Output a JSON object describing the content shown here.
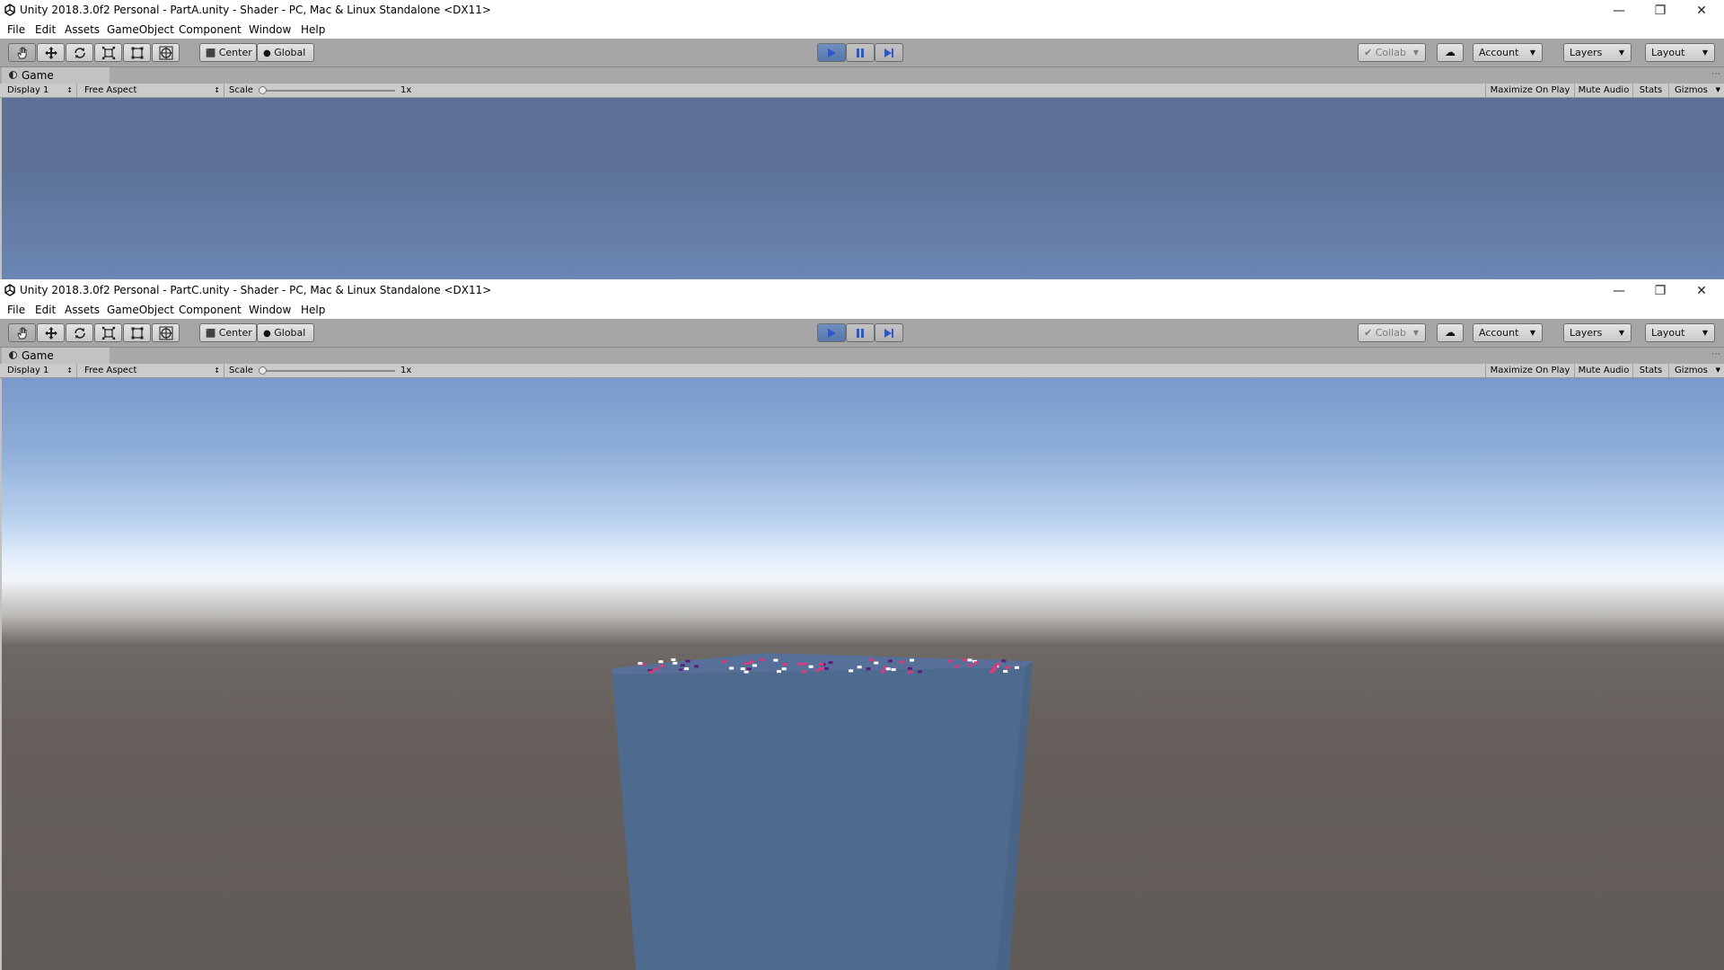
{
  "colors": {
    "cube_face": "#4f6a8f",
    "cube_side": "#4a6488",
    "cube_top": "#56709a",
    "pink": "#dc3a78",
    "purple": "#5b1f7a",
    "white": "#ffffff"
  },
  "windows": [
    {
      "title": "Unity 2018.3.0f2 Personal - PartA.unity - Shader - PC, Mac & Linux Standalone <DX11>"
    },
    {
      "title": "Unity 2018.3.0f2 Personal - PartC.unity - Shader - PC, Mac & Linux Standalone <DX11>"
    }
  ],
  "menu": [
    "File",
    "Edit",
    "Assets",
    "GameObject",
    "Component",
    "Window",
    "Help"
  ],
  "toolbar": {
    "tools": [
      "hand-icon",
      "move-icon",
      "rotate-icon",
      "scale-icon",
      "rect-transform-icon",
      "transform-icon"
    ],
    "pivot_label": "Center",
    "space_label": "Global",
    "collab_label": "Collab",
    "account_label": "Account",
    "layers_label": "Layers",
    "layout_label": "Layout",
    "playback_icons": [
      "play-icon",
      "pause-icon",
      "step-icon"
    ]
  },
  "game_tab": {
    "label": "Game",
    "display": "Display 1",
    "aspect": "Free Aspect",
    "scale_label": "Scale",
    "scale_value": "1x",
    "maximize_on_play": "Maximize On Play",
    "mute_audio": "Mute Audio",
    "stats": "Stats",
    "gizmos": "Gizmos"
  },
  "scenes": {
    "partA": "sky gradient only",
    "partC": "textured cube on ground plane under sky"
  }
}
